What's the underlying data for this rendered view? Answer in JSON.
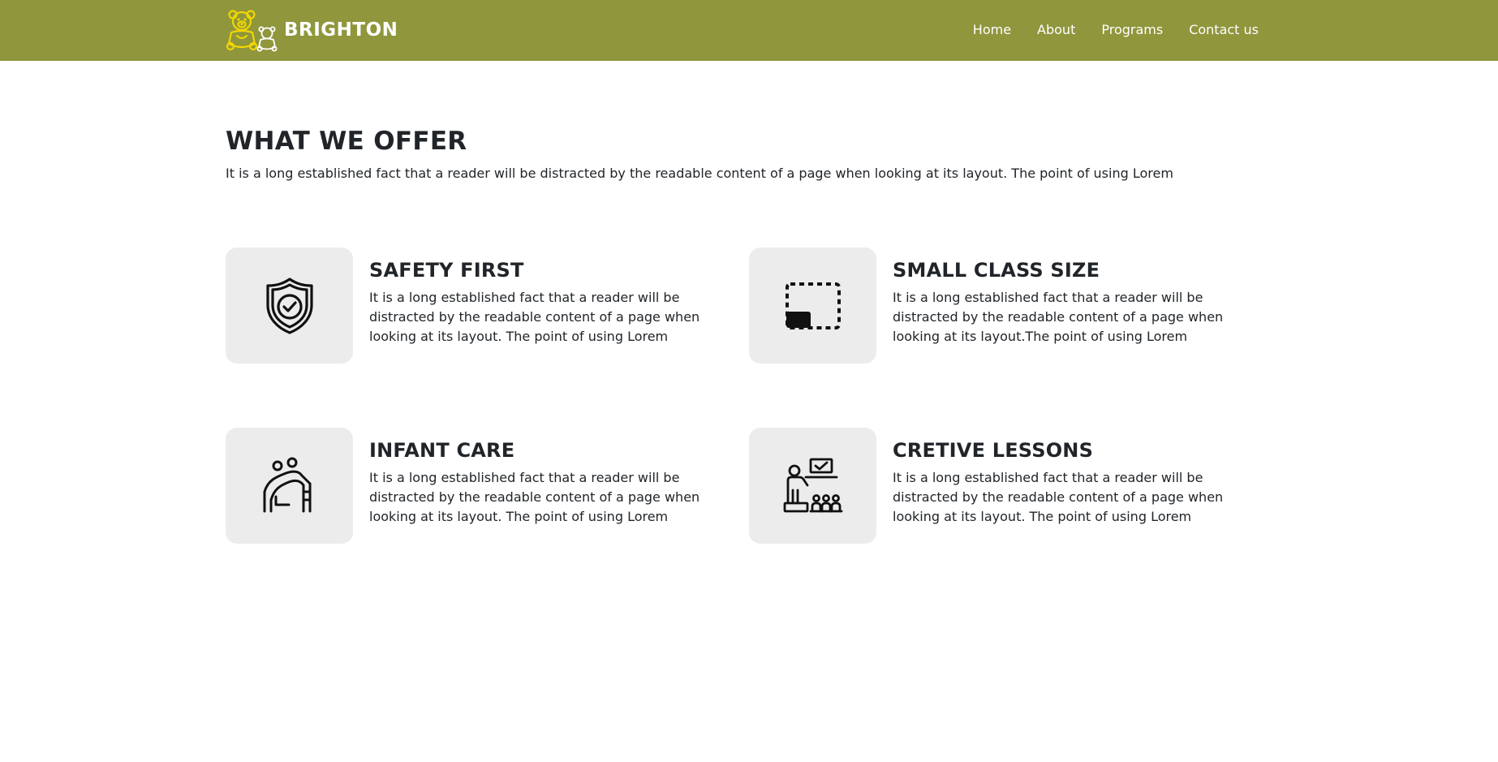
{
  "header": {
    "brand_name": "BRIGHTON",
    "logo_icon": "teddy-bear-logo",
    "background_color": "#8f963c",
    "logo_color": "#f2d600",
    "nav": [
      {
        "label": "Home"
      },
      {
        "label": "About"
      },
      {
        "label": "Programs"
      },
      {
        "label": "Contact us"
      }
    ]
  },
  "offer": {
    "title": "WHAT WE OFFER",
    "subtitle": "It is a long established fact that a reader will be distracted by the readable content of a page when looking at its layout. The point of using Lorem"
  },
  "features": [
    {
      "icon": "shield-check-icon",
      "title": "SAFETY FIRST",
      "text": "It is a long established fact that a reader will be distracted by the readable content of a page when looking at its layout. The point of using Lorem"
    },
    {
      "icon": "dashed-frame-icon",
      "title": "SMALL CLASS SIZE",
      "text": "It is a long established fact that a reader will be distracted by the readable content of a page when looking at its layout.The point of using Lorem"
    },
    {
      "icon": "playground-slide-icon",
      "title": "INFANT CARE",
      "text": "It is a long established fact that a reader will be distracted by the readable content of a page when looking at its layout. The point of using Lorem"
    },
    {
      "icon": "classroom-teacher-icon",
      "title": "CRETIVE LESSONS",
      "text": "It is a long established fact that a reader will be distracted by the readable content of a page when looking at its layout. The point of using Lorem"
    }
  ],
  "colors": {
    "card_background": "#ececec",
    "text": "#212529"
  }
}
